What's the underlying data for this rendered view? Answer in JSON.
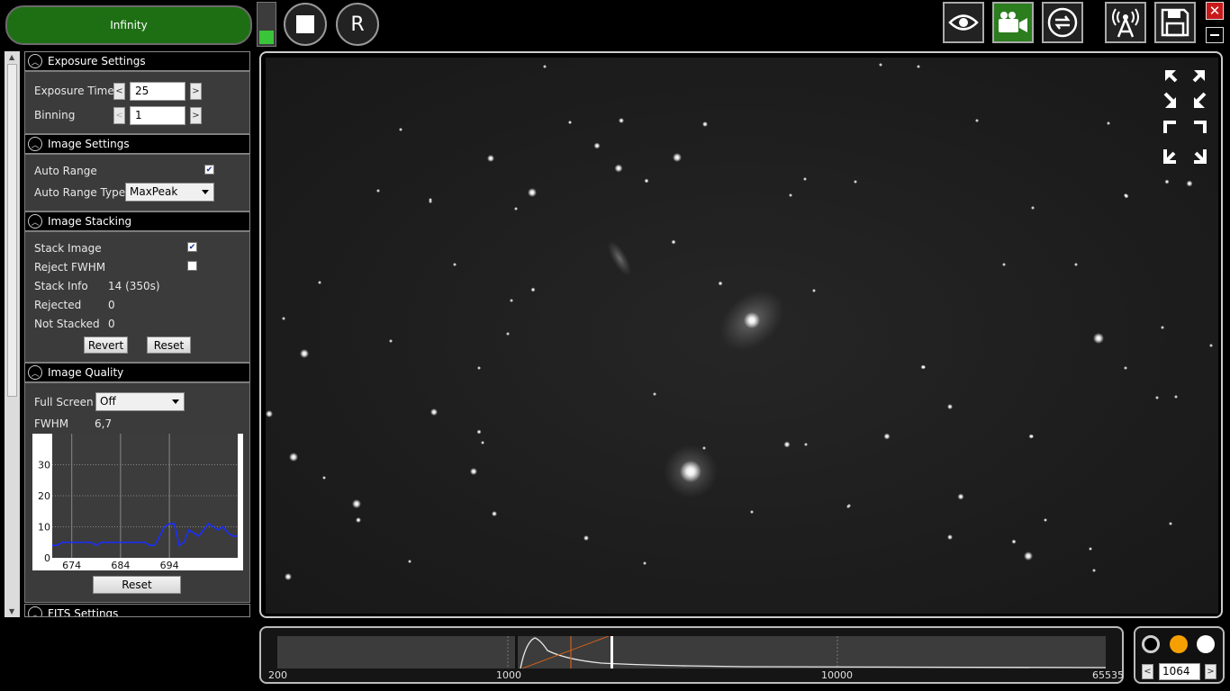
{
  "toolbar": {
    "infinity_label": "Infinity",
    "stop_icon": "stop-icon",
    "reset_label": "R",
    "signal_level": 0.35
  },
  "window_controls": {
    "close_label": "✕"
  },
  "exposure_settings": {
    "title": "Exposure Settings",
    "exposure_time_label": "Exposure Time",
    "exposure_time_value": "25",
    "binning_label": "Binning",
    "binning_value": "1",
    "dec_label": "<",
    "inc_label": ">"
  },
  "image_settings": {
    "title": "Image Settings",
    "auto_range_label": "Auto Range",
    "auto_range_checked": true,
    "auto_range_type_label": "Auto Range Type",
    "auto_range_type_value": "MaxPeak"
  },
  "image_stacking": {
    "title": "Image Stacking",
    "stack_image_label": "Stack Image",
    "stack_image_checked": true,
    "reject_fwhm_label": "Reject FWHM",
    "reject_fwhm_checked": false,
    "stack_info_label": "Stack Info",
    "stack_info_value": "14 (350s)",
    "rejected_label": "Rejected",
    "rejected_value": "0",
    "not_stacked_label": "Not Stacked",
    "not_stacked_value": "0",
    "revert_label": "Revert",
    "reset_label": "Reset"
  },
  "image_quality": {
    "title": "Image Quality",
    "full_screen_label": "Full Screen",
    "full_screen_value": "Off",
    "fwhm_label": "FWHM",
    "fwhm_value": "6,7",
    "reset_label": "Reset"
  },
  "fits_settings": {
    "title": "FITS Settings"
  },
  "chart_data": {
    "type": "line",
    "title": "",
    "xlabel": "",
    "ylabel": "",
    "xlim": [
      670,
      708
    ],
    "ylim": [
      0,
      40
    ],
    "y_ticks": [
      "0",
      "10",
      "20",
      "30"
    ],
    "x_ticks": [
      "674",
      "684",
      "694"
    ],
    "grid": true,
    "series": [
      {
        "color": "#1a2eff",
        "x": [
          670,
          671,
          672,
          673,
          674,
          675,
          676,
          677,
          678,
          679,
          680,
          681,
          682,
          683,
          684,
          685,
          686,
          687,
          688,
          689,
          690,
          691,
          692,
          693,
          694,
          695,
          696,
          697,
          698,
          699,
          700,
          701,
          702,
          703,
          704,
          705,
          706,
          707,
          708
        ],
        "values": [
          4,
          4,
          5,
          5,
          5,
          5,
          5,
          5,
          5,
          4,
          5,
          5,
          5,
          5,
          5,
          5,
          5,
          5,
          5,
          5,
          4,
          4,
          7,
          10,
          11,
          11,
          4,
          5,
          9,
          8,
          7,
          9,
          11,
          10,
          9,
          10,
          8,
          7,
          7
        ]
      }
    ]
  },
  "histogram": {
    "tick_labels": [
      "200",
      "1000",
      "10000",
      "65535"
    ]
  },
  "color_controls": {
    "dec_label": "<",
    "inc_label": ">",
    "value": "1064",
    "colors": [
      "#000000",
      "#f5a000",
      "#ffffff"
    ]
  }
}
